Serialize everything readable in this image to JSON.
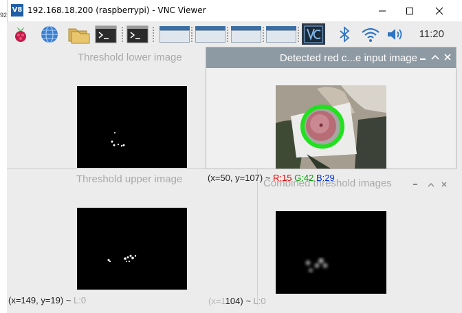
{
  "vnc_window": {
    "title": "192.168.18.200 (raspberrypi) - VNC Viewer",
    "logo_text": "V8",
    "controls": [
      "minimize-icon",
      "maximize-icon",
      "close-icon"
    ],
    "left_sliver_text": "92"
  },
  "taskbar": {
    "launchers": [
      "raspberry-menu-icon",
      "web-browser-icon",
      "file-manager-icon",
      "terminal-icon",
      "terminal-icon"
    ],
    "window_buttons": 4,
    "tray": [
      "vnc-icon",
      "bluetooth-icon",
      "wifi-icon",
      "volume-icon"
    ],
    "clock": "11:20",
    "accent": "#3a6ea5"
  },
  "windows": {
    "threshold_lower": {
      "title": "Threshold lower image"
    },
    "threshold_upper": {
      "title": "Threshold upper image",
      "status_coords": "(x=149, y=19) ~",
      "status_value": "L:0"
    },
    "combined": {
      "title": "Combined threshold images",
      "status_coords": "104) ~",
      "status_value": "L:0"
    },
    "detected": {
      "title": "Detected red c...e input image",
      "status_coords": "(x=50, y=107) ~",
      "r": "R:15",
      "g": "G:42",
      "b": "B:29",
      "header_color": "#8e9aa3"
    }
  }
}
